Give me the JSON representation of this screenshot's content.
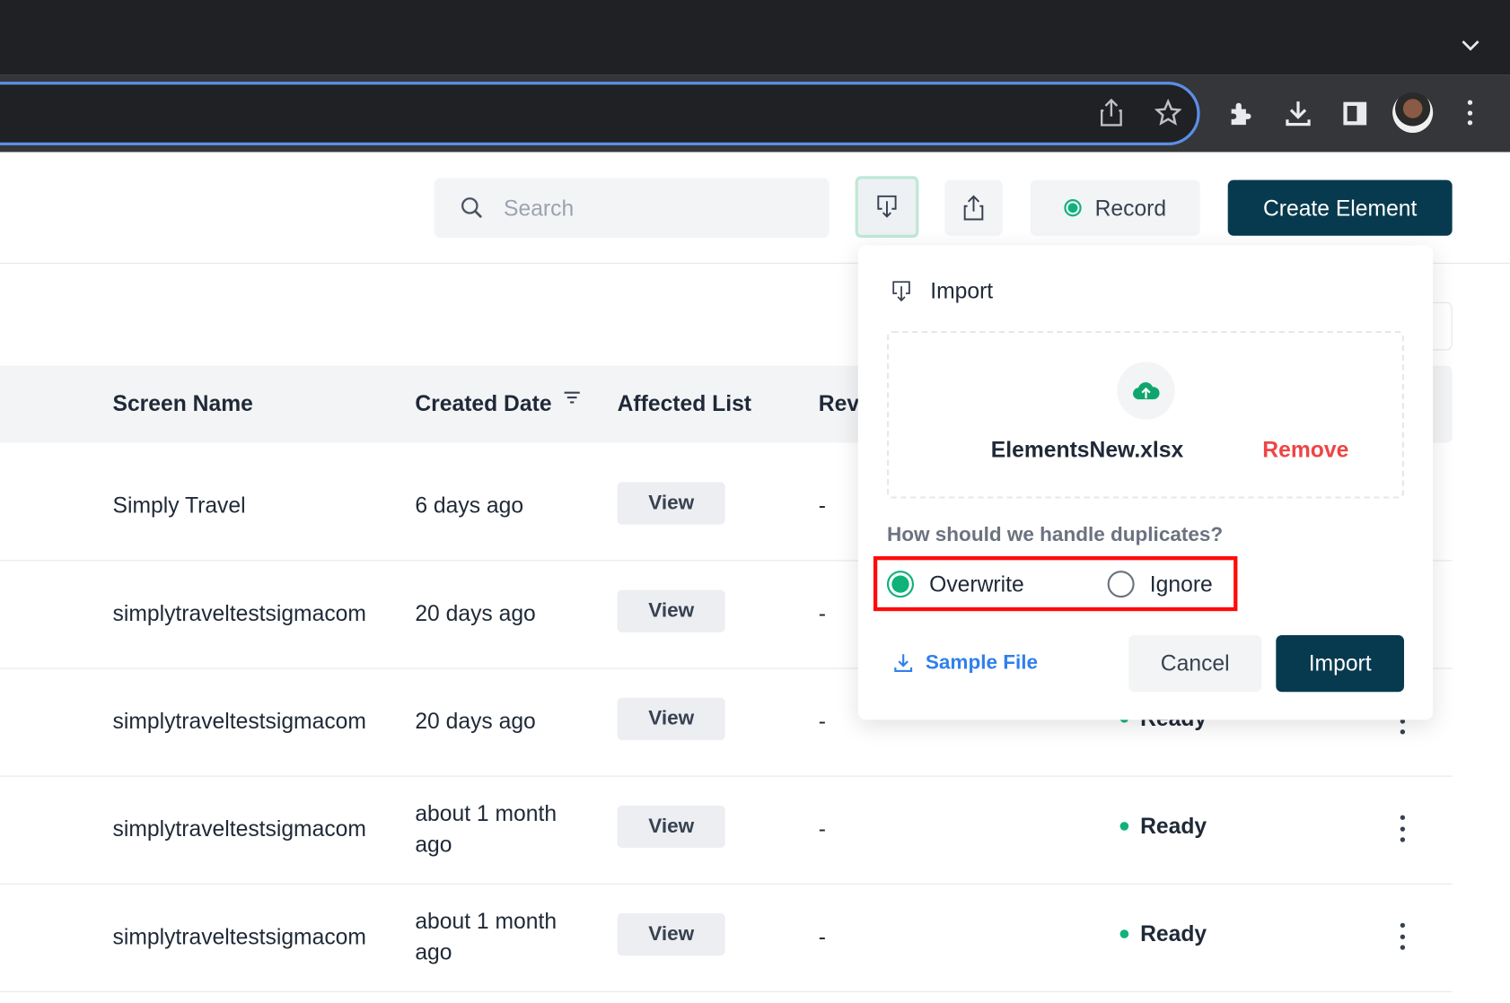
{
  "browser": {
    "icons": [
      "tab-list-chevron-icon",
      "share-icon",
      "bookmark-star-icon",
      "extensions-icon",
      "download-icon",
      "side-panel-icon",
      "profile-avatar",
      "browser-menu-icon"
    ]
  },
  "header": {
    "search_placeholder": "Search",
    "record_label": "Record",
    "create_label": "Create Element"
  },
  "table": {
    "columns": [
      "Screen Name",
      "Created Date",
      "Affected List",
      "Rev"
    ],
    "rows": [
      {
        "name": "Simply Travel",
        "created": "6 days ago",
        "affected": "View",
        "rev": "-",
        "status": ""
      },
      {
        "name": "simplytraveltestsigmacom",
        "created": "20 days ago",
        "affected": "View",
        "rev": "-",
        "status": ""
      },
      {
        "name": "simplytraveltestsigmacom",
        "created": "20 days ago",
        "affected": "View",
        "rev": "-",
        "status": "Ready"
      },
      {
        "name": "simplytraveltestsigmacom",
        "created": "about 1 month ago",
        "affected": "View",
        "rev": "-",
        "status": "Ready"
      },
      {
        "name": "simplytraveltestsigmacom",
        "created": "about 1 month ago",
        "affected": "View",
        "rev": "-",
        "status": "Ready"
      }
    ]
  },
  "import_popover": {
    "title": "Import",
    "file_name": "ElementsNew.xlsx",
    "remove_label": "Remove",
    "duplicates_question": "How should we handle duplicates?",
    "options": [
      {
        "label": "Overwrite",
        "selected": true
      },
      {
        "label": "Ignore",
        "selected": false
      }
    ],
    "sample_file_label": "Sample File",
    "cancel_label": "Cancel",
    "import_label": "Import"
  },
  "colors": {
    "primary": "#083a4f",
    "success": "#10b27a",
    "danger": "#ef4444",
    "link": "#2f80ed",
    "highlight": "#ff0000"
  }
}
